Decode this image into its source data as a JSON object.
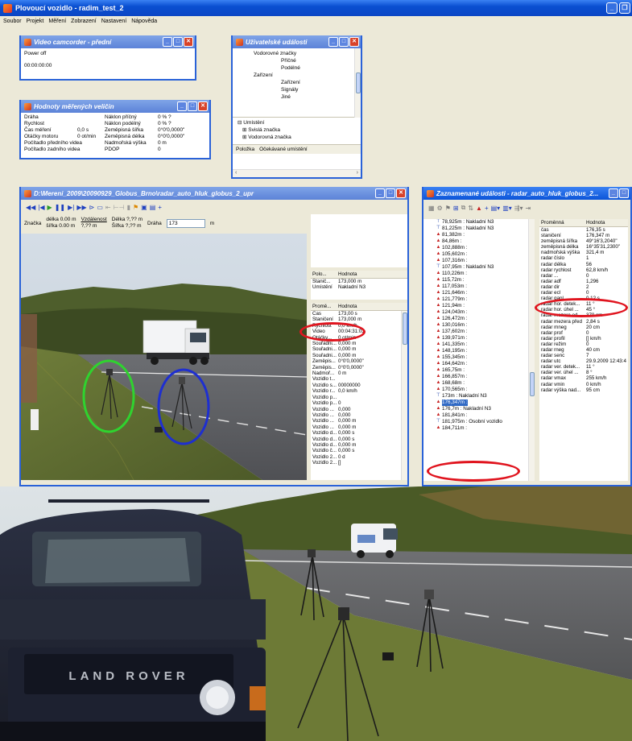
{
  "app": {
    "title": "Plovoucí vozidlo - radim_test_2",
    "menu": [
      "Soubor",
      "Projekt",
      "Měření",
      "Zobrazení",
      "Nastavení",
      "Nápověda"
    ]
  },
  "camcorder": {
    "title": "Video camcorder - přední",
    "status": "Power off",
    "time": "00:00:00:00"
  },
  "user_events": {
    "title": "Uživatelské události",
    "tree": [
      {
        "label": "Vodorovné značky",
        "level": 1
      },
      {
        "label": "Příčné",
        "level": 2
      },
      {
        "label": "Podélné",
        "level": 2
      },
      {
        "label": "Zařízení",
        "level": 1
      },
      {
        "label": "Zařízení",
        "level": 2
      },
      {
        "label": "Signály",
        "level": 2
      },
      {
        "label": "Jiné",
        "level": 2
      }
    ],
    "placement_tree": [
      "Umístění",
      "Svislá značka",
      "Vodorovná značka"
    ],
    "columns": [
      "Položka",
      "Očekávané umístění"
    ]
  },
  "measured_values": {
    "title": "Hodnoty měřených veličin",
    "rows": [
      [
        "Dráha",
        "",
        "Náklon příčný",
        "0 % ?"
      ],
      [
        "Rychlost",
        "",
        "Náklon podélný",
        "0 % ?"
      ],
      [
        "Čas měření",
        "0,0 s",
        "Zeměpisná šířka",
        "0°0'0,0000\""
      ],
      [
        "Otáčky motoru",
        "0 ot/min",
        "Zeměpisná délka",
        "0°0'0,0000\""
      ],
      [
        "Počítadlo předního videa",
        "",
        "Nadmořská výška",
        "0 m"
      ],
      [
        "Počítadlo zadního videa",
        "",
        "PDOP",
        "0"
      ]
    ]
  },
  "video_window": {
    "title": "D:\\Mereni_2009\\20090929_Globus_Brno\\radar_auto_hluk_globus_2_upr",
    "controls": {
      "znacka": "Značka",
      "delka_label": "délka",
      "delka_value": "0.00 m",
      "sirka_label": "šířka",
      "sirka_value": "0.00 m",
      "vzdalenost_label": "Vzdálenost",
      "vzdalenost_value": "?,?? m",
      "delka2_label": "Délka",
      "delka2_value": "?,?? m",
      "sirka2_label": "Šířka",
      "sirka2_value": "?,?? m",
      "draha_label": "Dráha",
      "draha_value": "173",
      "draha_unit": "m"
    },
    "position_grid": {
      "headers": [
        "Polo...",
        "Hodnota"
      ],
      "rows": [
        [
          "Stanič...",
          "173,000 m"
        ],
        [
          "Umístění",
          "Nakladní N3"
        ]
      ]
    },
    "value_grid": {
      "headers": [
        "Promě...",
        "Hodnota"
      ],
      "rows": [
        [
          "Čas",
          "173,00 s"
        ],
        [
          "Staničení",
          "173,000 m"
        ],
        [
          "Rychlost",
          "0,0 km/h"
        ],
        [
          "Video",
          "00:04:31:03"
        ],
        [
          "Otáčky...",
          "0 ot/min"
        ],
        [
          "Souřadni...",
          "0,000 m"
        ],
        [
          "Souřadni...",
          "0,000 m"
        ],
        [
          "Souřadni...",
          "0,000 m"
        ],
        [
          "Zeměpis...",
          "0°0'0,0000\""
        ],
        [
          "Zeměpis...",
          "0°0'0,0000\""
        ],
        [
          "Nadmoř...",
          "0 m"
        ],
        [
          "Vozidlo t...",
          ""
        ],
        [
          "Vozidlo s...",
          "00000000"
        ],
        [
          "Vozidlo r...",
          "0,0 km/h"
        ],
        [
          "Vozidlo p...",
          ""
        ],
        [
          "Vozidlo p...",
          "0"
        ],
        [
          "Vozidlo ...",
          "0,000"
        ],
        [
          "Vozidlo ...",
          "0,000"
        ],
        [
          "Vozidlo ...",
          "0,000 m"
        ],
        [
          "Vozidlo ...",
          "0,000 m"
        ],
        [
          "Vozidlo d...",
          "0,000 s"
        ],
        [
          "Vozidlo d...",
          "0,000 s"
        ],
        [
          "Vozidlo d...",
          "0,000 m"
        ],
        [
          "Vozidlo č...",
          "0,000 s"
        ],
        [
          "Vozidlo 2...",
          "0 d"
        ],
        [
          "Vozidlo 2...",
          "[]"
        ]
      ]
    }
  },
  "recorded_events": {
    "title": "Zaznamenané události - radar_auto_hluk_globus_2...",
    "list": [
      {
        "text": "78,925m : Nakladní N3",
        "icon": "sign"
      },
      {
        "text": "81,225m : Nakladní N3",
        "icon": "sign"
      },
      {
        "text": "81,382m :",
        "icon": "car"
      },
      {
        "text": "84,86m :",
        "icon": "car"
      },
      {
        "text": "102,888m :",
        "icon": "car"
      },
      {
        "text": "105,602m :",
        "icon": "car"
      },
      {
        "text": "107,316m :",
        "icon": "car"
      },
      {
        "text": "107,95m : Nakladní N3",
        "icon": "sign"
      },
      {
        "text": "110,226m :",
        "icon": "car"
      },
      {
        "text": "115,72m :",
        "icon": "car"
      },
      {
        "text": "117,053m :",
        "icon": "car"
      },
      {
        "text": "121,646m :",
        "icon": "car"
      },
      {
        "text": "121,779m :",
        "icon": "car"
      },
      {
        "text": "121,94m :",
        "icon": "car"
      },
      {
        "text": "124,043m :",
        "icon": "car"
      },
      {
        "text": "126,472m :",
        "icon": "car"
      },
      {
        "text": "130,016m :",
        "icon": "car"
      },
      {
        "text": "137,602m :",
        "icon": "car"
      },
      {
        "text": "139,971m :",
        "icon": "car"
      },
      {
        "text": "141,335m :",
        "icon": "car"
      },
      {
        "text": "148,195m :",
        "icon": "car"
      },
      {
        "text": "155,345m :",
        "icon": "car"
      },
      {
        "text": "164,642m :",
        "icon": "car"
      },
      {
        "text": "165,75m :",
        "icon": "car"
      },
      {
        "text": "166,857m :",
        "icon": "car"
      },
      {
        "text": "168,68m :",
        "icon": "car"
      },
      {
        "text": "170,565m :",
        "icon": "car"
      },
      {
        "text": "173m : Nakladní N3",
        "icon": "sign"
      },
      {
        "text": "176,347m :",
        "icon": "car",
        "selected": true
      },
      {
        "text": "176,7m : Nakladní N3",
        "icon": "car"
      },
      {
        "text": "181,841m :",
        "icon": "car"
      },
      {
        "text": "181,975m : Osobní vozidlo",
        "icon": "sign"
      },
      {
        "text": "184,711m :",
        "icon": "car"
      }
    ],
    "prop_headers": [
      "Proměnná",
      "Hodnota"
    ],
    "props": [
      [
        "čas",
        "176,35 s"
      ],
      [
        "staničení",
        "176,347 m"
      ],
      [
        "zeměpisná šířka",
        "49°16'3,2040\""
      ],
      [
        "zeměpisná délka",
        "16°35'31,2300\""
      ],
      [
        "nadmořská výška",
        "321,4 m"
      ],
      [
        "radar číslo",
        "1"
      ],
      [
        "radar délka",
        "56"
      ],
      [
        "radar rychlost",
        "62,8 km/h"
      ],
      [
        "radar ...",
        "0"
      ],
      [
        "radar adf",
        "1,296"
      ],
      [
        "radar dir",
        "2"
      ],
      [
        "radar ecl",
        "0"
      ],
      [
        "radar gapl",
        "0,12 s"
      ],
      [
        "radar hor. detek...",
        "11 °"
      ],
      [
        "radar hor. úhel ...",
        "45 °"
      ],
      [
        "radar mezera od...",
        "370 cm"
      ],
      [
        "radar mezera před",
        "2,84 s"
      ],
      [
        "radar mneg",
        "20 cm"
      ],
      [
        "radar prof",
        "0"
      ],
      [
        "radar profil",
        "[] km/h"
      ],
      [
        "radar režim",
        "0"
      ],
      [
        "radar rneg",
        "40 cm"
      ],
      [
        "radar senc",
        "7"
      ],
      [
        "radar utc",
        "29.9.2009 12:43:4"
      ],
      [
        "radar ver. detek...",
        "11 °"
      ],
      [
        "radar ver. úhel ...",
        "8 °"
      ],
      [
        "radar vmax",
        "255 km/h"
      ],
      [
        "radar vmin",
        "0 km/h"
      ],
      [
        "radar výška nad...",
        "95 cm"
      ]
    ]
  },
  "photo": {
    "vehicle_brand": "LAND ROVER"
  },
  "colors": {
    "highlight_ellipse": "#e0141e",
    "green_ring": "#2fd32f",
    "blue_ring": "#1e2fd0",
    "titlebar": "#0b54d8"
  }
}
